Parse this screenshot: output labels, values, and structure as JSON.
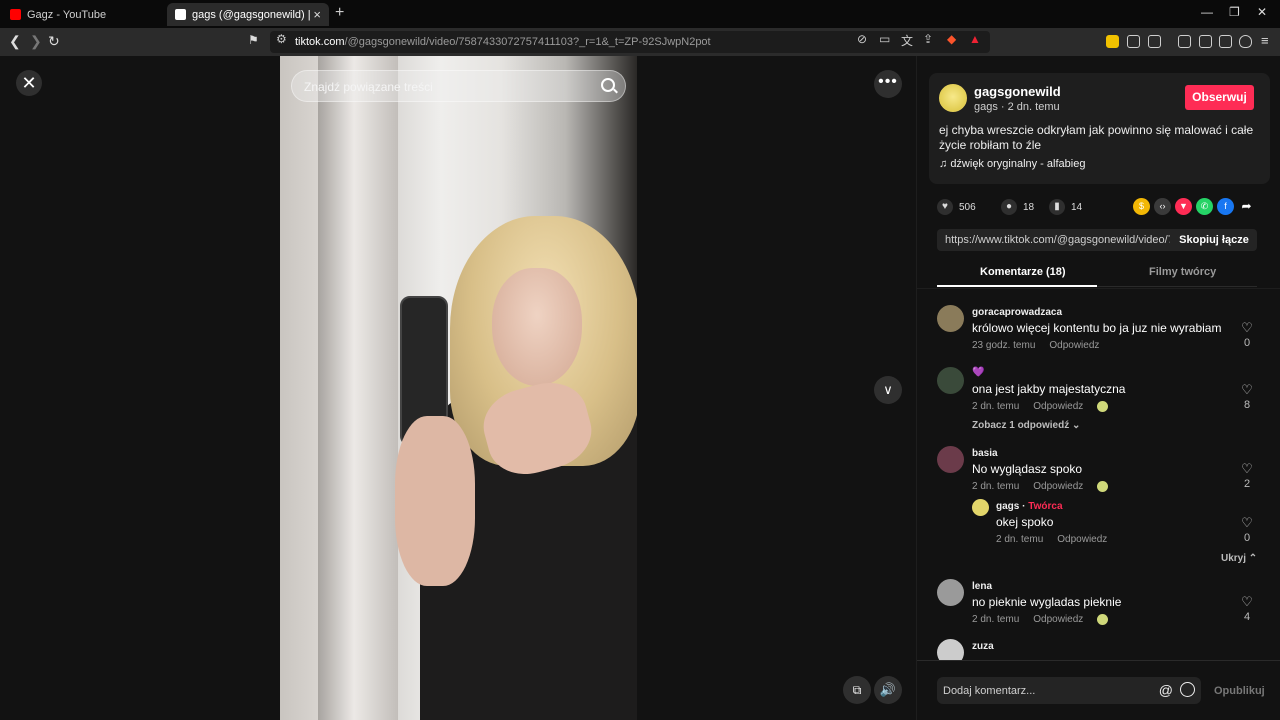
{
  "browser": {
    "tabs": [
      {
        "title": "Gagz - YouTube",
        "favicon_color": "#ff0000"
      },
      {
        "title": "gags (@gagsgonewild) | TikTok",
        "favicon_color": "#ffffff"
      }
    ],
    "url_domain": "tiktok.com",
    "url_path": "/@gagsgonewild/video/7587433072757411103?_r=1&_t=ZP-92SJwpN2pot"
  },
  "video": {
    "search_placeholder": "Znajdź powiązane treści"
  },
  "post": {
    "username": "gagsgonewild",
    "submeta": "gags · 2 dn. temu",
    "follow_label": "Obserwuj",
    "description": "ej chyba wreszcie odkryłam jak powinno się malować i całe życie robiłam to źle",
    "music": "dźwięk oryginalny - alfabieg",
    "likes": "506",
    "comments_count": "18",
    "saves": "14",
    "link": "https://www.tiktok.com/@gagsgonewild/video/758...",
    "copy_label": "Skopiuj łącze",
    "tab_comments": "Komentarze (18)",
    "tab_creator": "Filmy twórcy"
  },
  "comments": [
    {
      "user": "goracaprowadzaca",
      "text": "królowo więcej kontentu bo ja juz nie wyrabiam",
      "time": "23 godz. temu",
      "reply": "Odpowiedz",
      "likes": "0",
      "avatar": "#8a7b5a"
    },
    {
      "user": "💜",
      "text": "ona jest jakby majestatyczna",
      "time": "2 dn. temu",
      "reply": "Odpowiedz",
      "likes": "8",
      "avatar": "#3a4a3a",
      "view_replies": "Zobacz 1 odpowiedź ⌄"
    },
    {
      "user": "basia",
      "text": "No wyglądasz spoko",
      "time": "2 dn. temu",
      "reply": "Odpowiedz",
      "likes": "2",
      "avatar": "#6b3b4a"
    },
    {
      "user": "gags",
      "creator_tag": "Twórca",
      "text": "okej spoko",
      "time": "2 dn. temu",
      "reply": "Odpowiedz",
      "likes": "0",
      "avatar": "#e2d56a",
      "hide_label": "Ukryj ⌃"
    },
    {
      "user": "lena",
      "text": "no pieknie wygladas pieknie",
      "time": "2 dn. temu",
      "reply": "Odpowiedz",
      "likes": "4",
      "avatar": "#9a9a9a"
    },
    {
      "user": "zuza",
      "avatar": "#cccccc"
    }
  ],
  "composer": {
    "placeholder": "Dodaj komentarz...",
    "publish_label": "Opublikuj"
  }
}
